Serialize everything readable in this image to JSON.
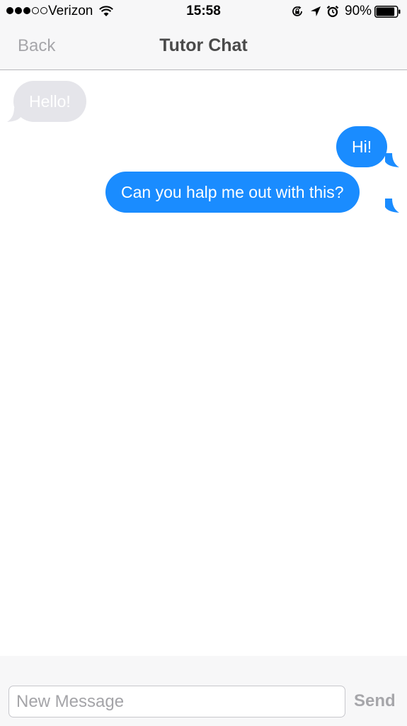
{
  "status_bar": {
    "signal_bars_filled": 3,
    "signal_bars_total": 5,
    "carrier": "Verizon",
    "time": "15:58",
    "battery_percent": "90%",
    "battery_level": 0.9,
    "icons": [
      "wifi-icon",
      "rotation-lock-icon",
      "location-arrow-icon",
      "alarm-icon",
      "battery-icon"
    ]
  },
  "nav": {
    "back_label": "Back",
    "title": "Tutor Chat"
  },
  "messages": [
    {
      "direction": "incoming",
      "text": "Hello!"
    },
    {
      "direction": "outgoing",
      "text": "Hi!"
    },
    {
      "direction": "outgoing",
      "text": "Can you halp me out with this?"
    }
  ],
  "composer": {
    "placeholder": "New Message",
    "value": "",
    "send_label": "Send"
  },
  "colors": {
    "outgoing_bubble": "#1a8cff",
    "incoming_bubble": "#e5e5ea",
    "bar_background": "#f7f7f8",
    "disabled_text": "#a6a6aa"
  }
}
